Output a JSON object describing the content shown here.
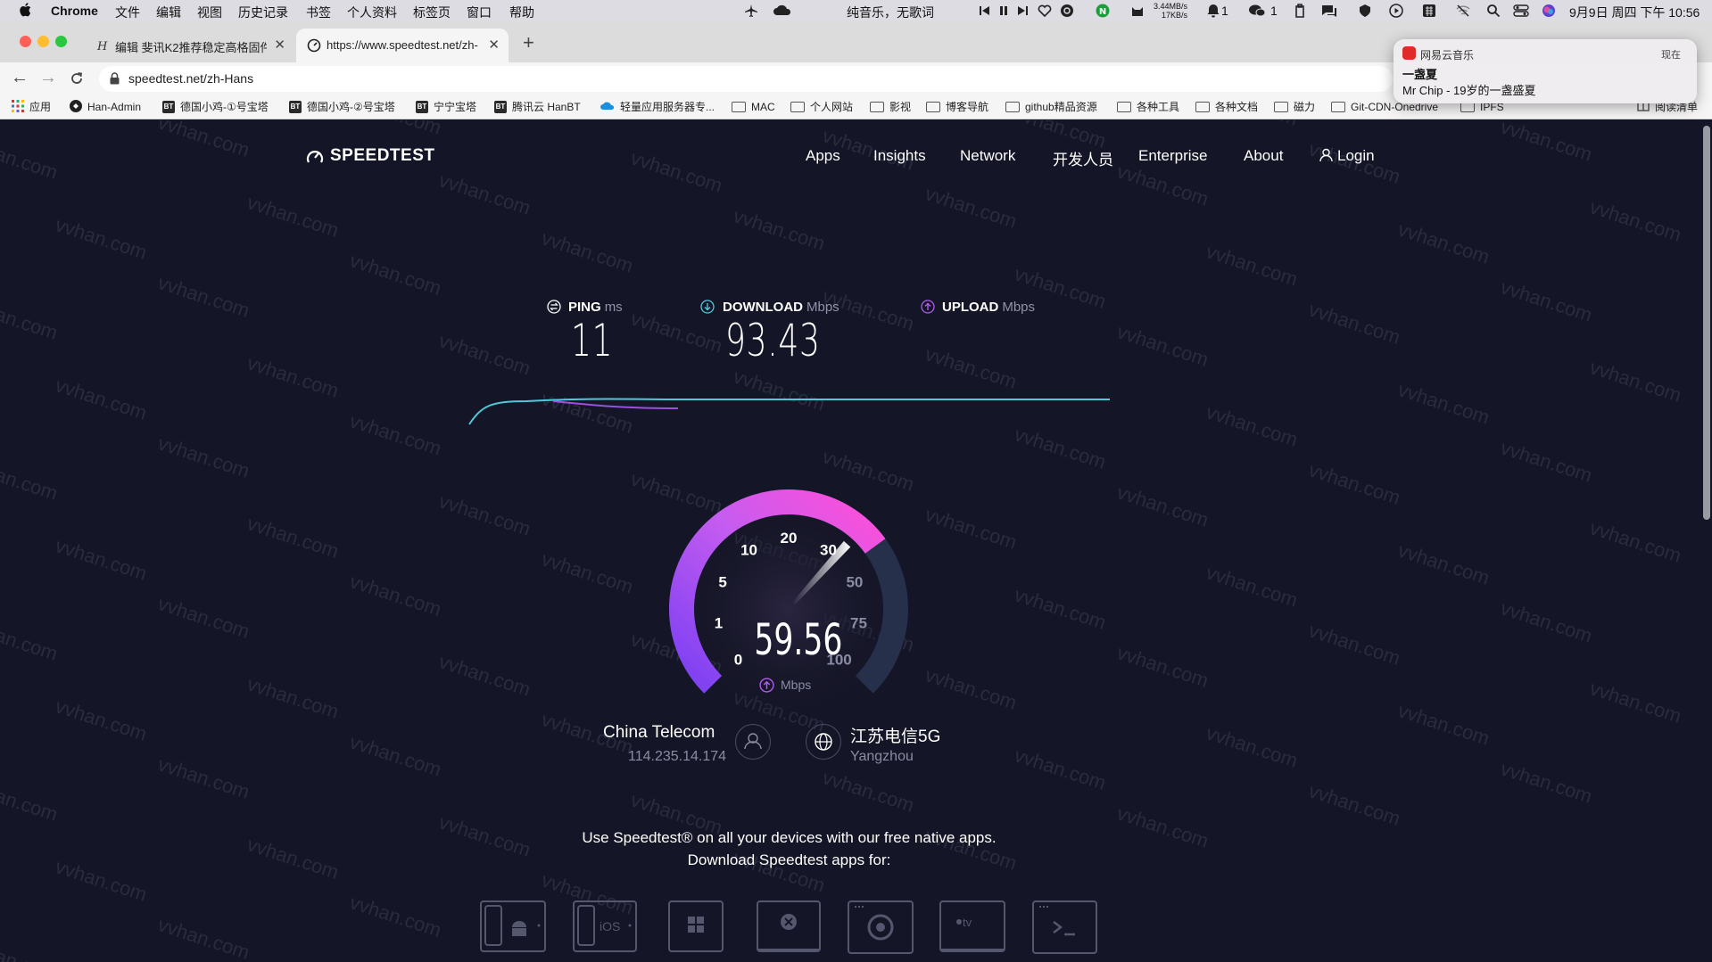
{
  "menubar": {
    "app": "Chrome",
    "items": [
      "文件",
      "编辑",
      "视图",
      "历史记录",
      "书签",
      "个人资料",
      "标签页",
      "窗口",
      "帮助"
    ],
    "music_status": "纯音乐，无歌词",
    "net_up": "3.44MB/s",
    "net_down": "17KB/s",
    "notif_count": "1",
    "wechat_count": "1",
    "clock": "9月9日 周四 下午 10:56"
  },
  "tabs": [
    {
      "title": "编辑 斐讯K2推荐稳定高格固件 -",
      "active": false
    },
    {
      "title": "https://www.speedtest.net/zh-",
      "active": true
    }
  ],
  "address": {
    "url": "speedtest.net/zh-Hans"
  },
  "bookmarks": [
    {
      "label": "应用",
      "icon": "apps-grid-icon"
    },
    {
      "label": "Han-Admin",
      "icon": "site-icon"
    },
    {
      "label": "德国小鸡-①号宝塔",
      "icon": "bt-icon"
    },
    {
      "label": "德国小鸡-②号宝塔",
      "icon": "bt-icon"
    },
    {
      "label": "宁宁宝塔",
      "icon": "bt-icon"
    },
    {
      "label": "腾讯云 HanBT",
      "icon": "bt-icon"
    },
    {
      "label": "轻量应用服务器专...",
      "icon": "cloud-icon"
    },
    {
      "label": "MAC",
      "icon": "folder-icon"
    },
    {
      "label": "个人网站",
      "icon": "folder-icon"
    },
    {
      "label": "影视",
      "icon": "folder-icon"
    },
    {
      "label": "博客导航",
      "icon": "folder-icon"
    },
    {
      "label": "github精品资源",
      "icon": "folder-icon"
    },
    {
      "label": "各种工具",
      "icon": "folder-icon"
    },
    {
      "label": "各种文档",
      "icon": "folder-icon"
    },
    {
      "label": "磁力",
      "icon": "folder-icon"
    },
    {
      "label": "Git-CDN-Onedrive",
      "icon": "folder-icon"
    },
    {
      "label": "IPFS",
      "icon": "folder-icon"
    },
    {
      "label": "阅读清单",
      "icon": "reading-list-icon"
    }
  ],
  "notification": {
    "app": "网易云音乐",
    "time": "现在",
    "title": "一盏夏",
    "body": "Mr Chip - 19岁的一盏盛夏"
  },
  "site": {
    "logo": "SPEEDTEST",
    "nav": [
      "Apps",
      "Insights",
      "Network",
      "开发人员",
      "Enterprise",
      "About",
      "Login"
    ]
  },
  "results": {
    "ping": {
      "label": "PING",
      "unit": "ms",
      "value": "11"
    },
    "download": {
      "label": "DOWNLOAD",
      "unit": "Mbps",
      "value": "93.43"
    },
    "upload": {
      "label": "UPLOAD",
      "unit": "Mbps",
      "value": ""
    }
  },
  "gauge": {
    "ticks": [
      "0",
      "1",
      "5",
      "10",
      "20",
      "30",
      "50",
      "75",
      "100"
    ],
    "current_speed": "59.56",
    "unit": "Mbps",
    "fill_fraction": 0.7,
    "colors": {
      "start": "#7a3ff2",
      "end": "#ff4fd8",
      "track": "#26304a"
    }
  },
  "connection": {
    "isp": "China Telecom",
    "ip": "114.235.14.174",
    "server": "江苏电信5G",
    "location": "Yangzhou"
  },
  "promo": {
    "line1": "Use Speedtest® on all your devices with our free native apps.",
    "line2": "Download Speedtest apps for:",
    "platforms": [
      "android",
      "iOS",
      "windows",
      "mac",
      "chrome",
      "tv",
      "cli"
    ]
  },
  "watermark": "vvhan.com",
  "colors": {
    "page_bg": "#141526",
    "download_line": "#4fc9d8",
    "upload_line": "#a04fe0"
  }
}
